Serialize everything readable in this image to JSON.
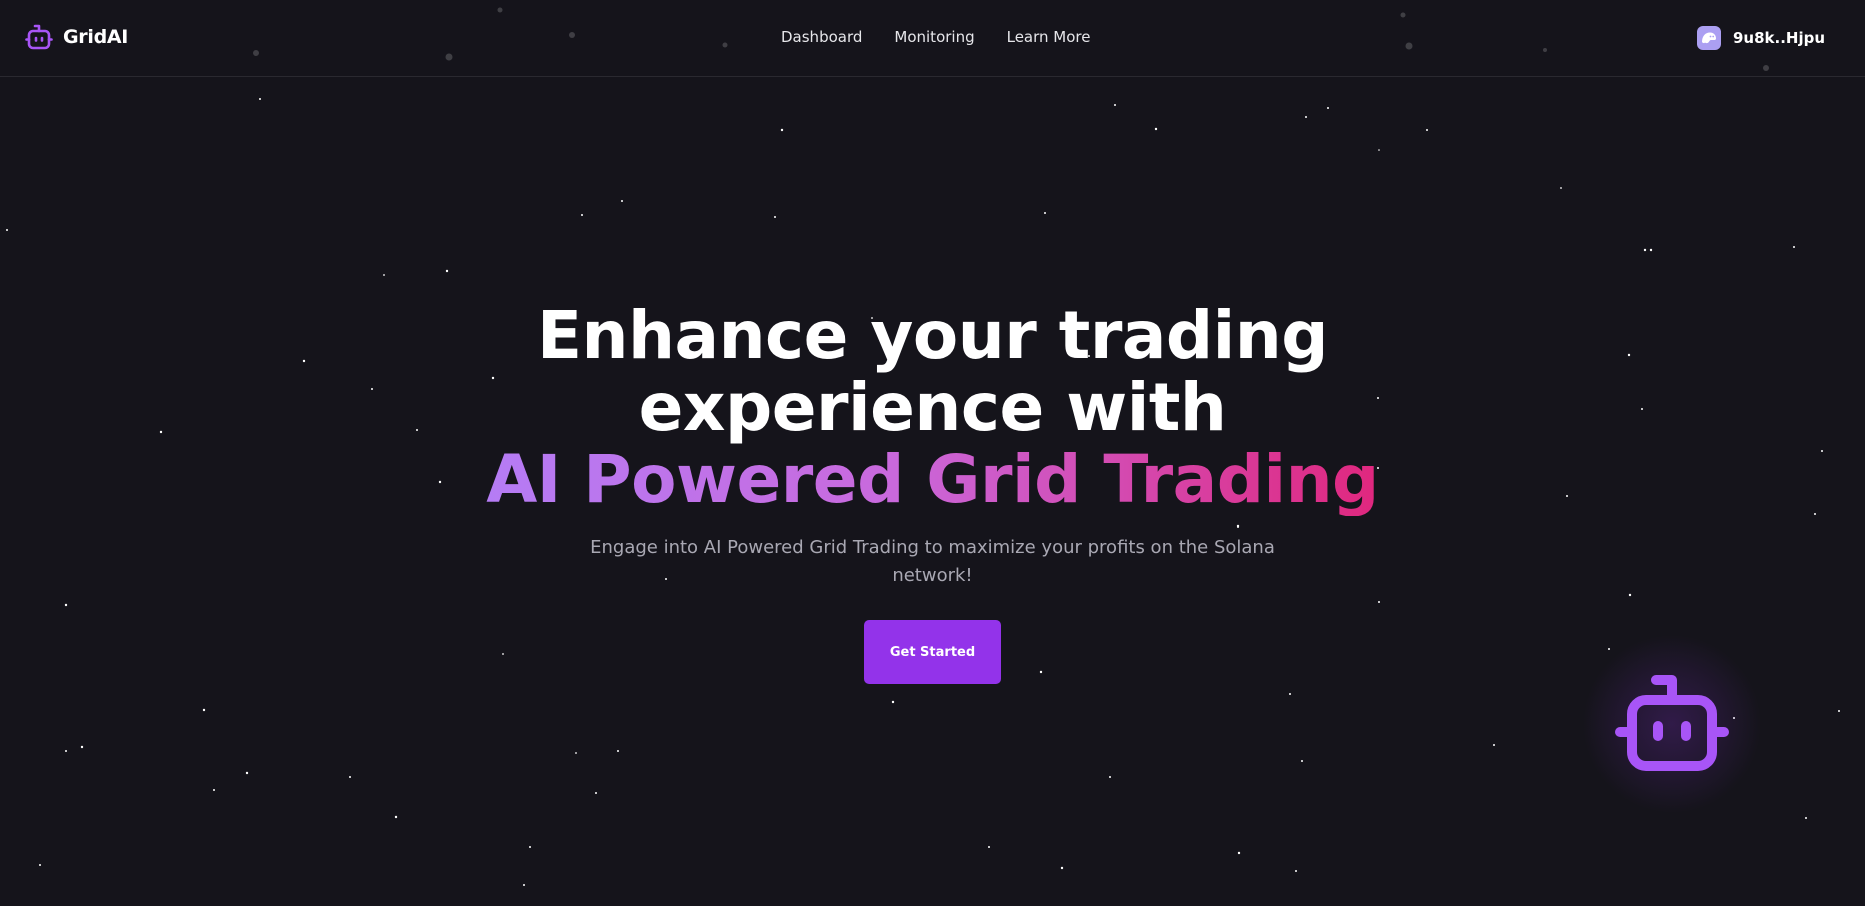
{
  "navbar": {
    "brand": {
      "name": "GridAI",
      "icon": "robot-icon"
    },
    "links": [
      {
        "label": "Dashboard"
      },
      {
        "label": "Monitoring"
      },
      {
        "label": "Learn More"
      }
    ],
    "wallet": {
      "address": "9u8k..Hjpu",
      "icon": "phantom-wallet-icon"
    }
  },
  "hero": {
    "title_line1": "Enhance your trading",
    "title_line2": "experience with",
    "title_highlight": "AI Powered Grid Trading",
    "subtitle": "Engage into AI Powered Grid Trading to maximize your profits on the Solana network!",
    "cta_label": "Get Started"
  },
  "floating_widget": {
    "icon": "robot-icon"
  },
  "colors": {
    "background": "#15141b",
    "accent": "#9333ea",
    "bot_purple": "#a855f7",
    "gradient_start": "#b57cf5",
    "gradient_end": "#e0277e",
    "subtitle": "#a9a8b3"
  }
}
